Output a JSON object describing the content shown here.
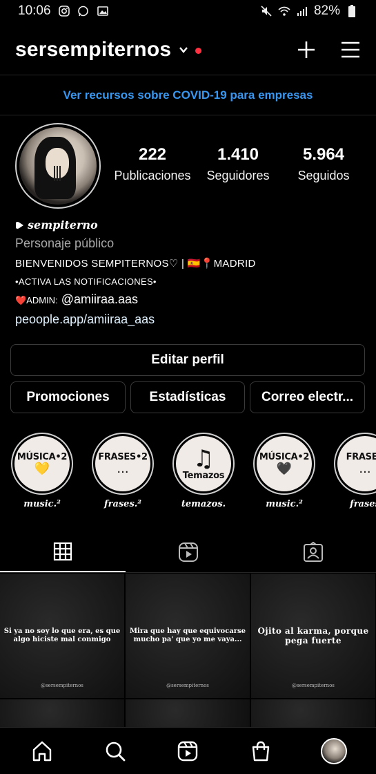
{
  "status_bar": {
    "time": "10:06",
    "battery": "82%"
  },
  "header": {
    "username": "sersempiternos"
  },
  "covid_link": "Ver recursos sobre COVID-19 para empresas",
  "stats": [
    {
      "value": "222",
      "label": "Publicaciones"
    },
    {
      "value": "1.410",
      "label": "Seguidores"
    },
    {
      "value": "5.964",
      "label": "Seguidos"
    }
  ],
  "bio": {
    "name": "sempiterno",
    "category": "Personaje público",
    "line1": "BIENVENIDOS SEMPITERNOS♡ | 🇪🇸📍MADRID",
    "line2": "•ACTIVA LAS NOTIFICACIONES•",
    "line3_prefix": "❤️ADMIN:",
    "line3_handle": " @amiiraa.aas",
    "link": "peoople.app/amiiraa_aas"
  },
  "buttons": {
    "edit_profile": "Editar perfil",
    "promotions": "Promociones",
    "insights": "Estadísticas",
    "email": "Correo electr..."
  },
  "highlights": [
    {
      "title": "MÚSICA•2",
      "glyph": "💛",
      "caption": "music.²"
    },
    {
      "title": "FRASES•2",
      "glyph": "...",
      "caption": "frases.²"
    },
    {
      "title": "Temazos",
      "glyph": "♫",
      "caption": "temazos."
    },
    {
      "title": "MÚSICA•2",
      "glyph": "🖤",
      "caption": "music.²"
    },
    {
      "title": "FRASES",
      "glyph": "...",
      "caption": "frases"
    }
  ],
  "posts": [
    {
      "text": "Si ya no soy lo que era, es que algo hiciste mal conmigo",
      "watermark": "@sersempiternos"
    },
    {
      "text": "Mira que hay que equivocarse mucho pa' que yo me vaya...",
      "watermark": "@sersempiternos"
    },
    {
      "text": "Ojito al karma, porque pega fuerte",
      "watermark": "@sersempiternos"
    }
  ],
  "colors": {
    "link_blue": "#3897f0",
    "notification_dot": "#ff3040",
    "border": "#3a3a3a"
  }
}
